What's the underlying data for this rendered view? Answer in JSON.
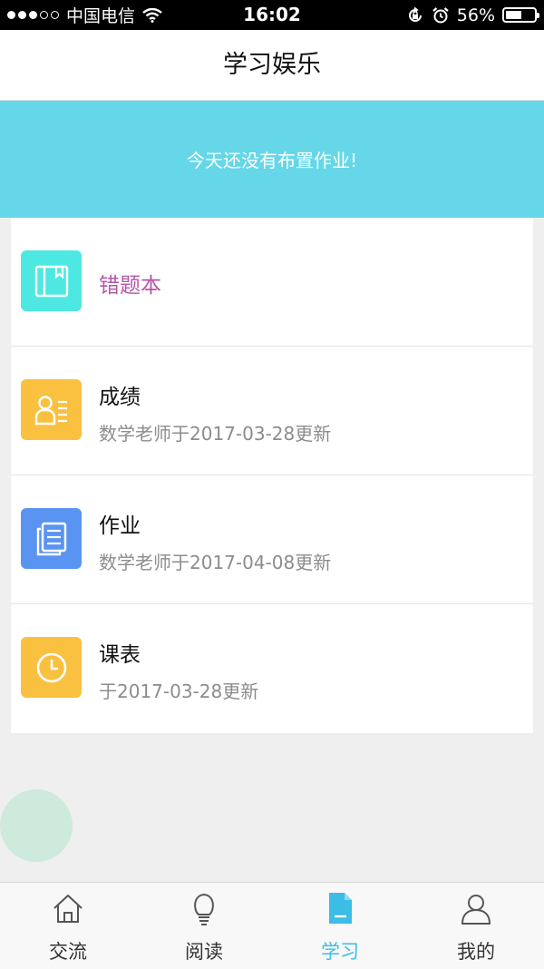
{
  "status_bar": {
    "carrier": "中国电信",
    "time": "16:02",
    "battery": "56%",
    "battery_level": 0.56
  },
  "header": {
    "title": "学习娱乐"
  },
  "banner": {
    "text": "今天还没有布置作业!"
  },
  "menu": {
    "items": [
      {
        "title": "错题本",
        "subtitle": "",
        "title_color": "#b455a8",
        "icon": "book-icon",
        "icon_color": "#4ee8e2"
      },
      {
        "title": "成绩",
        "subtitle": "数学老师于2017-03-28更新",
        "title_color": "#111111",
        "icon": "contact-card-icon",
        "icon_color": "#f9c13f"
      },
      {
        "title": "作业",
        "subtitle": "数学老师于2017-04-08更新",
        "title_color": "#111111",
        "icon": "document-icon",
        "icon_color": "#5a94f2"
      },
      {
        "title": "课表",
        "subtitle": "于2017-03-28更新",
        "title_color": "#111111",
        "icon": "clock-icon",
        "icon_color": "#f9c13f"
      }
    ]
  },
  "tabbar": {
    "items": [
      {
        "label": "交流",
        "icon": "home-icon",
        "active": false
      },
      {
        "label": "阅读",
        "icon": "lightbulb-icon",
        "active": false
      },
      {
        "label": "学习",
        "icon": "document-icon",
        "active": true
      },
      {
        "label": "我的",
        "icon": "person-icon",
        "active": false
      }
    ],
    "active_color": "#3bbde5"
  }
}
